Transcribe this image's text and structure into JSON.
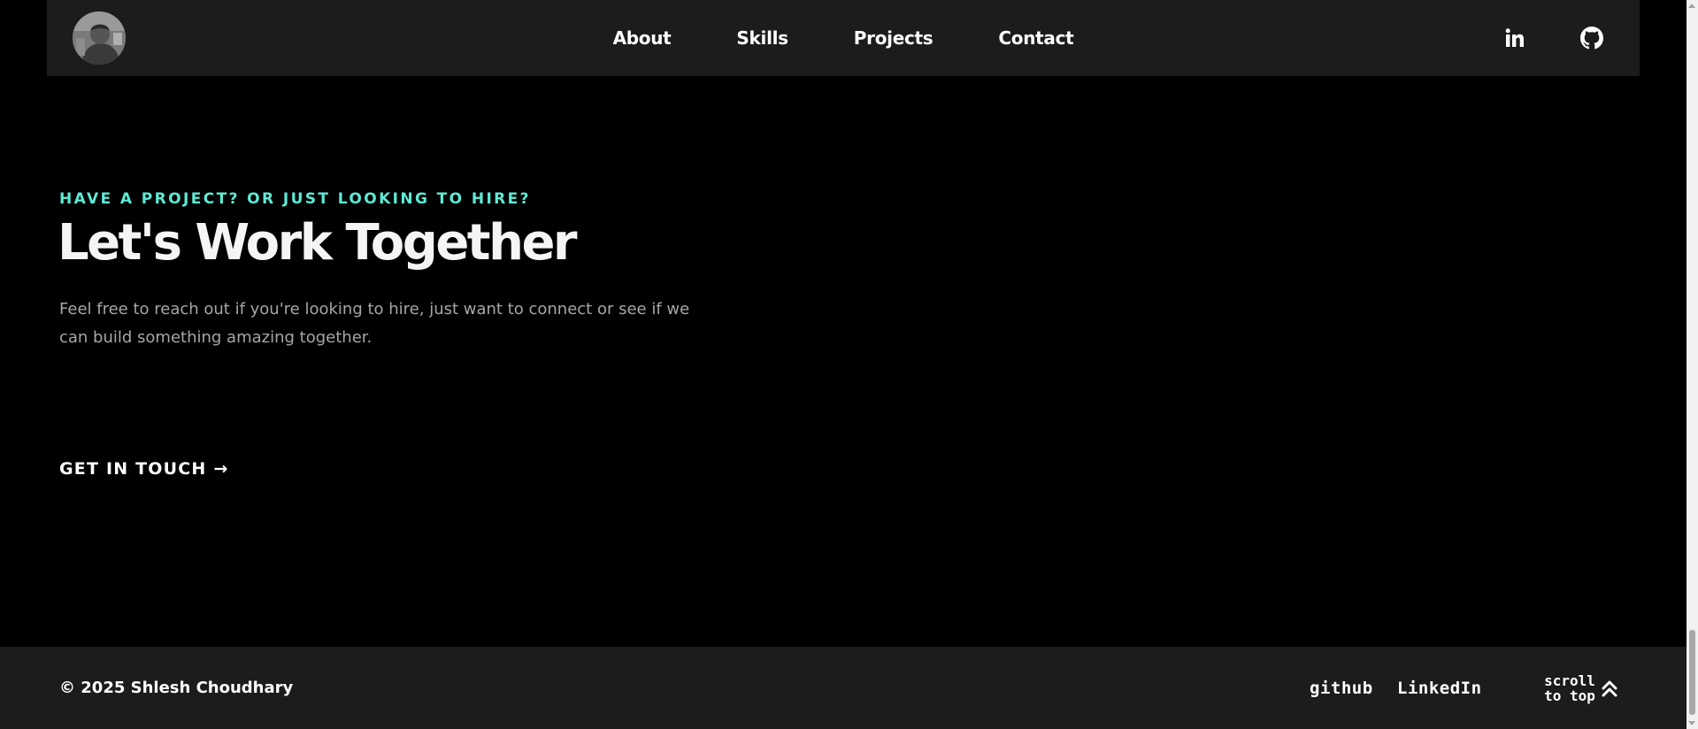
{
  "nav": {
    "links": [
      {
        "label": "About"
      },
      {
        "label": "Skills"
      },
      {
        "label": "Projects"
      },
      {
        "label": "Contact"
      }
    ],
    "social": [
      {
        "icon": "linkedin-icon"
      },
      {
        "icon": "github-icon"
      }
    ]
  },
  "hero": {
    "eyebrow": "HAVE A PROJECT? OR JUST LOOKING TO HIRE?",
    "title": "Let's Work Together",
    "description": "Feel free to reach out if you're looking to hire, just want to connect or see if we can build something amazing together.",
    "cta": "GET IN TOUCH →"
  },
  "footer": {
    "copyright": "© 2025 Shlesh Choudhary",
    "links": [
      {
        "label": "github"
      },
      {
        "label": "LinkedIn"
      }
    ],
    "scroll_top": {
      "line1": "scroll",
      "line2": "to top",
      "icon": "double-chevron-up-icon"
    }
  },
  "colors": {
    "background": "#000000",
    "surface": "#1c1c1c",
    "accent": "#5eead4",
    "text": "#ffffff",
    "muted_text": "#a6a6a6"
  }
}
